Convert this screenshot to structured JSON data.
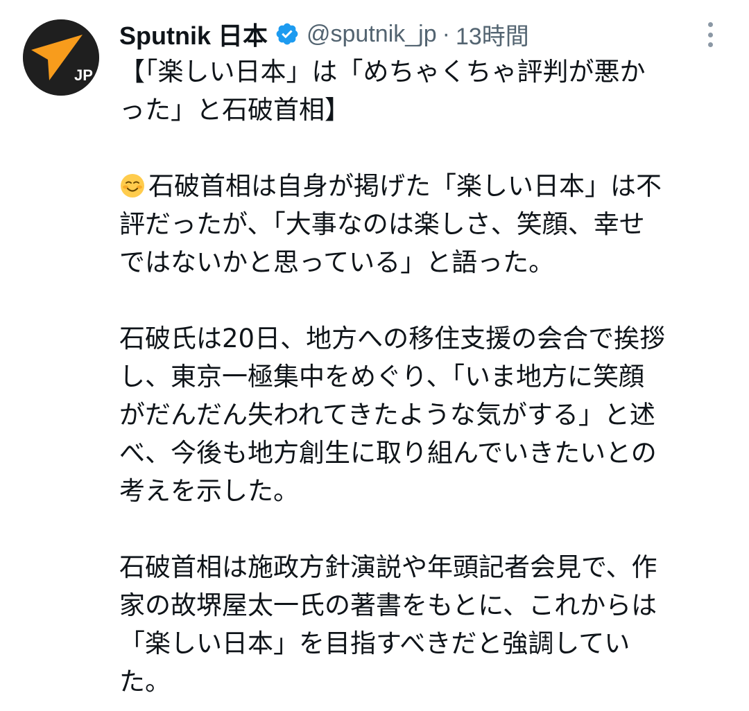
{
  "author": {
    "display_name": "Sputnik 日本",
    "handle": "@sputnik_jp",
    "separator": "·",
    "time": "13時間",
    "avatar_label": "JP",
    "verified_icon": "verified-badge-icon",
    "brand_color": "#f89c1c",
    "verified_color": "#1d9bf0"
  },
  "tweet": {
    "headline_lines": [
      "【「楽しい日本」は「めちゃくちゃ評判が悪か",
      "った」と石破首相】"
    ],
    "para1_emoji": "smiling-face-icon",
    "para1_lines": [
      "石破首相は自身が掲げた「楽しい日本」は不",
      "評だったが、「大事なのは楽しさ、笑顔、幸せ",
      "ではないかと思っている」と語った。"
    ],
    "para2_lines": [
      "石破氏は20日、地方への移住支援の会合で挨拶",
      "し、東京一極集中をめぐり、「いま地方に笑顔",
      "がだんだん失われてきたような気がする」と述",
      "べ、今後も地方創生に取り組んでいきたいとの",
      "考えを示した。"
    ],
    "para3_lines": [
      "石破首相は施政方針演説や年頭記者会見で、作",
      "家の故堺屋太一氏の著書をもとに、これからは",
      "「楽しい日本」を目指すべきだと強調してい",
      "た。"
    ]
  },
  "menu": {
    "icon": "more-vertical-icon"
  }
}
